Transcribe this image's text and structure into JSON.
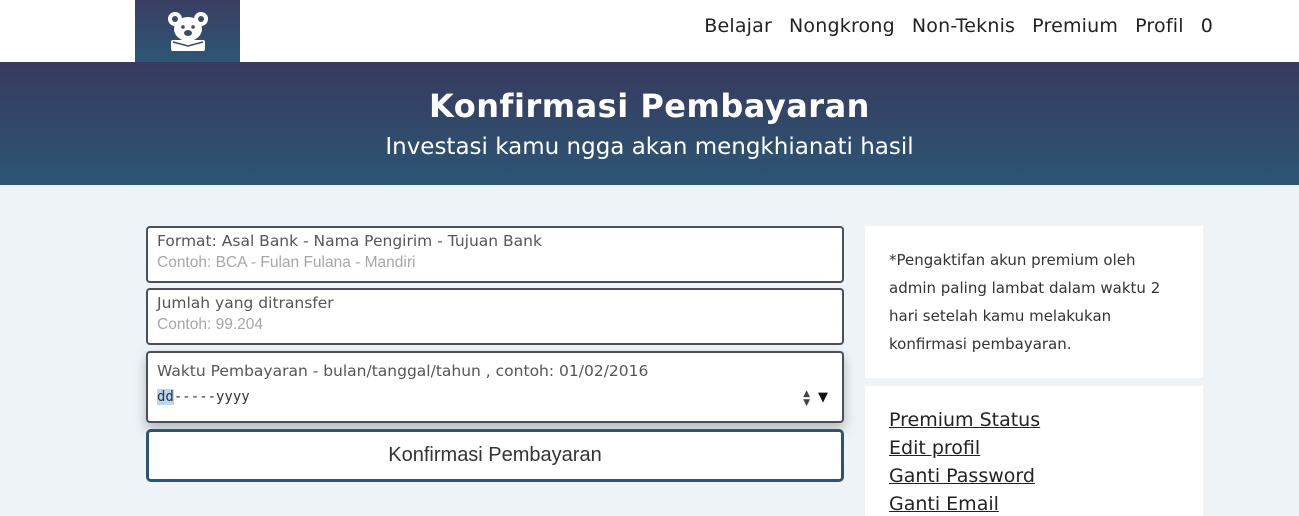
{
  "logo": {
    "icon": "teddy-bear-logo-icon"
  },
  "nav": {
    "items": [
      "Belajar",
      "Nongkrong",
      "Non-Teknis",
      "Premium",
      "Profil",
      "0"
    ]
  },
  "hero": {
    "title": "Konfirmasi Pembayaran",
    "subtitle": "Investasi kamu ngga akan mengkhianati hasil"
  },
  "form": {
    "bank": {
      "label": "Format: Asal Bank - Nama Pengirim - Tujuan Bank",
      "placeholder": "Contoh: BCA - Fulan Fulana - Mandiri"
    },
    "amount": {
      "label": "Jumlah yang ditransfer",
      "placeholder": "Contoh: 99.204"
    },
    "date": {
      "label": "Waktu Pembayaran - bulan/tanggal/tahun , contoh: 01/02/2016",
      "value_selected": "dd",
      "value_rest": "-----yyyy"
    },
    "submit_label": "Konfirmasi Pembayaran"
  },
  "notice": {
    "text": "*Pengaktifan akun premium oleh admin paling lambat dalam waktu 2 hari setelah kamu melakukan konfirmasi pembayaran."
  },
  "sidebar_links": [
    "Premium Status",
    "Edit profil",
    "Ganti Password",
    "Ganti Email"
  ],
  "colors": {
    "header_top": "#383a5e",
    "header_bottom": "#2c5675",
    "background": "#eef3f7"
  }
}
